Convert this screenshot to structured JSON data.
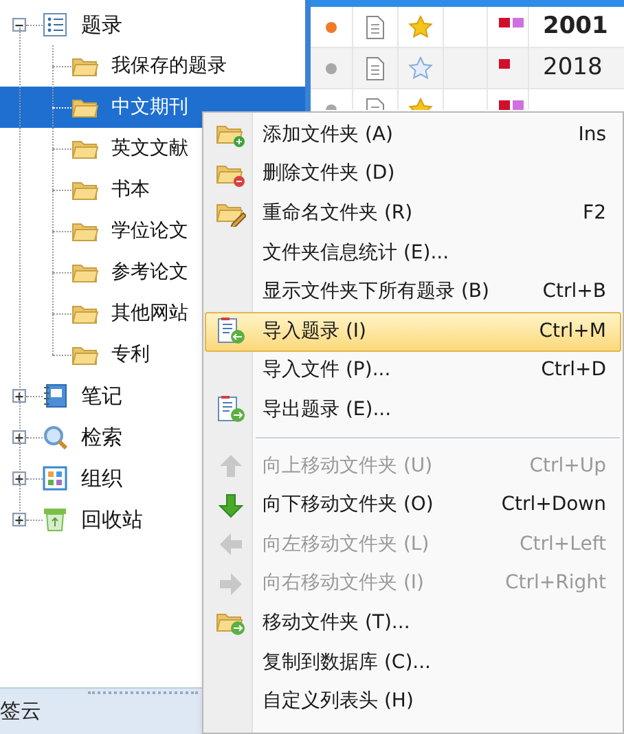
{
  "tree": [
    {
      "label": "题录",
      "expanded": true,
      "selected": false,
      "children": [
        {
          "label": "我保存的题录",
          "selected": false
        },
        {
          "label": "中文期刊",
          "selected": true
        },
        {
          "label": "英文文献",
          "selected": false
        },
        {
          "label": "书本",
          "selected": false
        },
        {
          "label": "学位论文",
          "selected": false
        },
        {
          "label": "参考论文",
          "selected": false
        },
        {
          "label": "其他网站",
          "selected": false
        },
        {
          "label": "专利",
          "selected": false
        }
      ]
    },
    {
      "label": "笔记",
      "expanded": false,
      "selected": false
    },
    {
      "label": "检索",
      "expanded": false,
      "selected": false
    },
    {
      "label": "组织",
      "expanded": false,
      "selected": false
    },
    {
      "label": "回收站",
      "expanded": false,
      "selected": false
    }
  ],
  "bottom_panel": {
    "title": "签云"
  },
  "table": {
    "rows": [
      {
        "color": "#f07a2a",
        "starred": true,
        "tags": [
          {
            "color": "#d0102a"
          },
          {
            "color": "#d070e0"
          }
        ],
        "year": "2001",
        "bold": true
      },
      {
        "color": "#a8a8a8",
        "starred": false,
        "tags": [
          {
            "color": "#d0102a"
          }
        ],
        "year": "2018",
        "bold": false
      },
      {
        "color": "#a8a8a8",
        "starred": true,
        "tags": [
          {
            "color": "#d0102a"
          },
          {
            "color": "#d070e0"
          }
        ]
      }
    ]
  },
  "context_menu": [
    {
      "kind": "item",
      "label": "添加文件夹 (A)",
      "shortcut": "Ins",
      "disabled": false,
      "selected": false
    },
    {
      "kind": "item",
      "label": "删除文件夹 (D)",
      "disabled": false,
      "selected": false
    },
    {
      "kind": "item",
      "label": "重命名文件夹 (R)",
      "shortcut": "F2",
      "disabled": false,
      "selected": false
    },
    {
      "kind": "item",
      "label": "文件夹信息统计 (E)...",
      "disabled": false,
      "selected": false
    },
    {
      "kind": "item",
      "label": "显示文件夹下所有题录 (B)",
      "shortcut": "Ctrl+B",
      "disabled": false,
      "selected": false
    },
    {
      "kind": "item",
      "label": "导入题录 (I)",
      "shortcut": "Ctrl+M",
      "disabled": false,
      "selected": true
    },
    {
      "kind": "item",
      "label": "导入文件 (P)...",
      "shortcut": "Ctrl+D",
      "disabled": false,
      "selected": false
    },
    {
      "kind": "item",
      "label": "导出题录 (E)...",
      "disabled": false,
      "selected": false
    },
    {
      "kind": "separator"
    },
    {
      "kind": "item",
      "label": "向上移动文件夹 (U)",
      "shortcut": "Ctrl+Up",
      "disabled": true,
      "selected": false
    },
    {
      "kind": "item",
      "label": "向下移动文件夹 (O)",
      "shortcut": "Ctrl+Down",
      "disabled": false,
      "selected": false
    },
    {
      "kind": "item",
      "label": "向左移动文件夹 (L)",
      "shortcut": "Ctrl+Left",
      "disabled": true,
      "selected": false
    },
    {
      "kind": "item",
      "label": "向右移动文件夹 (I)",
      "shortcut": "Ctrl+Right",
      "disabled": true,
      "selected": false
    },
    {
      "kind": "item",
      "label": "移动文件夹 (T)...",
      "disabled": false,
      "selected": false
    },
    {
      "kind": "item",
      "label": "复制到数据库 (C)...",
      "disabled": false,
      "selected": false
    },
    {
      "kind": "item",
      "label": "自定义列表头 (H)",
      "disabled": false,
      "selected": false
    }
  ]
}
